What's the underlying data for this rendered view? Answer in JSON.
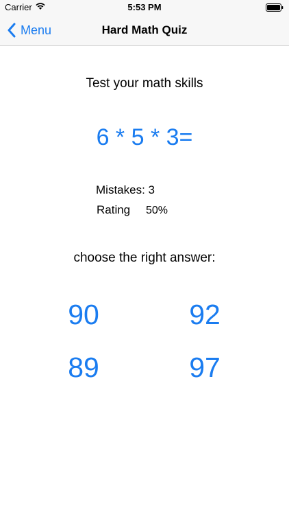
{
  "status_bar": {
    "carrier": "Carrier",
    "time": "5:53 PM",
    "wifi_icon": "wifi-icon",
    "battery_icon": "battery-icon"
  },
  "nav": {
    "back_label": "Menu",
    "back_icon": "chevron-left-icon",
    "title": "Hard Math Quiz"
  },
  "quiz": {
    "subtitle": "Test your math skills",
    "question": "6 * 5 * 3=",
    "mistakes": "Mistakes: 3",
    "rating_label": "Rating",
    "rating_value": "50%",
    "prompt": "choose the right answer:",
    "answers": [
      "90",
      "92",
      "89",
      "97"
    ]
  },
  "colors": {
    "accent": "#1a7cf0",
    "nav_background": "#f7f7f7",
    "text": "#000000"
  }
}
